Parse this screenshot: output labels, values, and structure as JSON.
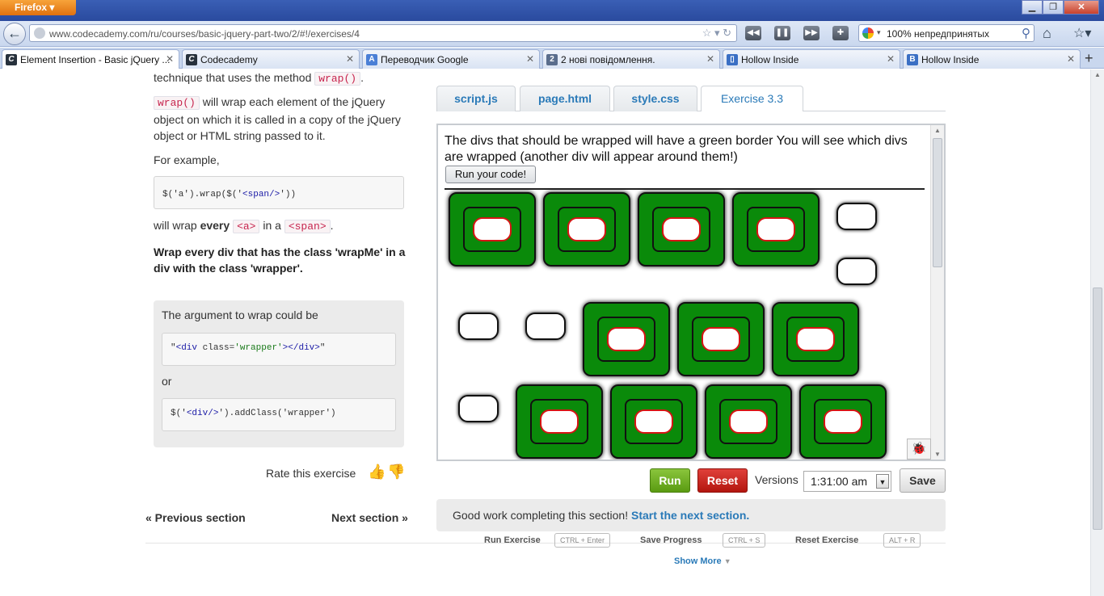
{
  "browser": {
    "menu_label": "Firefox",
    "url": "www.codecademy.com/ru/courses/basic-jquery-part-two/2/#!/exercises/4",
    "search_text": "100% непредпринятых",
    "tabs": [
      {
        "label": "Element Insertion - Basic jQuery ...",
        "active": true
      },
      {
        "label": "Codecademy",
        "active": false
      },
      {
        "label": "Переводчик Google",
        "active": false
      },
      {
        "label": "2 нові повідомлення.",
        "active": false
      },
      {
        "label": "Hollow Inside",
        "active": false
      },
      {
        "label": "Hollow Inside",
        "active": false
      }
    ]
  },
  "lesson": {
    "intro_text": "technique that uses the method",
    "method": "wrap()",
    "p2_rest": "will wrap each element of the jQuery object on which it is called in a copy of the jQuery object or HTML string passed to it.",
    "for_example": "For example,",
    "example_code_a": "$('a').wrap($('",
    "example_code_span": "<span/>",
    "example_code_b": "'))",
    "will_wrap": "will wrap",
    "every": "every",
    "tag_a": "<a>",
    "in_a": "in a",
    "tag_span": "<span>",
    "instruction": "Wrap every div that has the class 'wrapMe' in a div with the class 'wrapper'.",
    "hint_title": "The argument to wrap could be",
    "hint_code1_q": "\"",
    "hint_code1_a": "<div",
    "hint_code1_b": "class",
    "hint_code1_c": "=",
    "hint_code1_d": "'wrapper'",
    "hint_code1_e": "></div>",
    "hint_code1_f": "\"",
    "hint_or": "or",
    "hint_code2_a": "$('",
    "hint_code2_b": "<div/>",
    "hint_code2_c": "').addClass('wrapper')",
    "rate_label": "Rate this exercise",
    "prev_section": "« Previous section",
    "next_section": "Next section »"
  },
  "editor": {
    "tabs": [
      "script.js",
      "page.html",
      "style.css",
      "Exercise 3.3"
    ],
    "active_tab": "Exercise 3.3",
    "result_text": "The divs that should be wrapped will have a green border You will see which divs are wrapped (another div will appear around them!)",
    "run_code_label": "Run your code!",
    "run_label": "Run",
    "reset_label": "Reset",
    "versions_label": "Versions",
    "version_value": "1:31:00 am",
    "save_label": "Save",
    "done_text": "Good work completing this section!",
    "done_link": "Start the next section.",
    "shortcuts": [
      {
        "label": "Run Exercise",
        "keys": "CTRL + Enter"
      },
      {
        "label": "Save Progress",
        "keys": "CTRL + S"
      },
      {
        "label": "Reset Exercise",
        "keys": "ALT + R"
      }
    ],
    "show_more": "Show More"
  },
  "colors": {
    "wrapper_green": "#0a8a0a",
    "inner_border_red": "#d61414",
    "link_blue": "#2a7ab8",
    "run_green": "#5a9b12",
    "reset_red": "#b3160f"
  }
}
